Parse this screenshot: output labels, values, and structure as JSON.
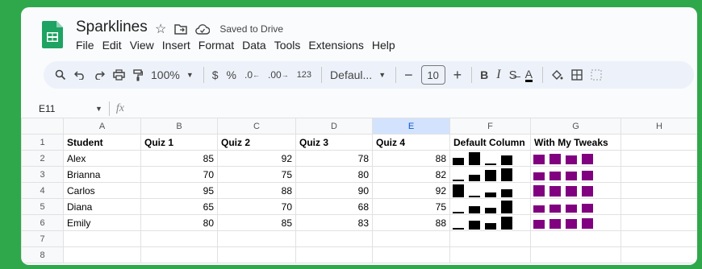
{
  "app": {
    "title": "Sparklines",
    "saved_status": "Saved to Drive",
    "menu": [
      "File",
      "Edit",
      "View",
      "Insert",
      "Format",
      "Data",
      "Tools",
      "Extensions",
      "Help"
    ]
  },
  "toolbar": {
    "zoom": "100%",
    "currency": "$",
    "percent": "%",
    "dec_decrease": ".0",
    "dec_increase": ".00",
    "number_format": "123",
    "font": "Defaul...",
    "font_size": "10",
    "bold": "B",
    "italic": "I",
    "text_color": "A"
  },
  "formula_bar": {
    "cell_ref": "E11",
    "fx": "fx"
  },
  "sheet": {
    "columns": [
      "A",
      "B",
      "C",
      "D",
      "E",
      "F",
      "G",
      "H"
    ],
    "headers": [
      "Student",
      "Quiz 1",
      "Quiz 2",
      "Quiz 3",
      "Quiz 4",
      "Default Column",
      "With My Tweaks",
      ""
    ],
    "rows": [
      {
        "num": "2",
        "student": "Alex",
        "q": [
          "85",
          "92",
          "78",
          "88"
        ],
        "spark": [
          85,
          92,
          78,
          88
        ]
      },
      {
        "num": "3",
        "student": "Brianna",
        "q": [
          "70",
          "75",
          "80",
          "82"
        ],
        "spark": [
          70,
          75,
          80,
          82
        ]
      },
      {
        "num": "4",
        "student": "Carlos",
        "q": [
          "95",
          "88",
          "90",
          "92"
        ],
        "spark": [
          95,
          88,
          90,
          92
        ]
      },
      {
        "num": "5",
        "student": "Diana",
        "q": [
          "65",
          "70",
          "68",
          "75"
        ],
        "spark": [
          65,
          70,
          68,
          75
        ]
      },
      {
        "num": "6",
        "student": "Emily",
        "q": [
          "80",
          "85",
          "83",
          "88"
        ],
        "spark": [
          80,
          85,
          83,
          88
        ]
      }
    ],
    "row_numbers": [
      "1",
      "2",
      "3",
      "4",
      "5",
      "6",
      "7",
      "8"
    ],
    "default_color": "#000000",
    "tweak_color": "#800080",
    "selected_column": "E"
  }
}
